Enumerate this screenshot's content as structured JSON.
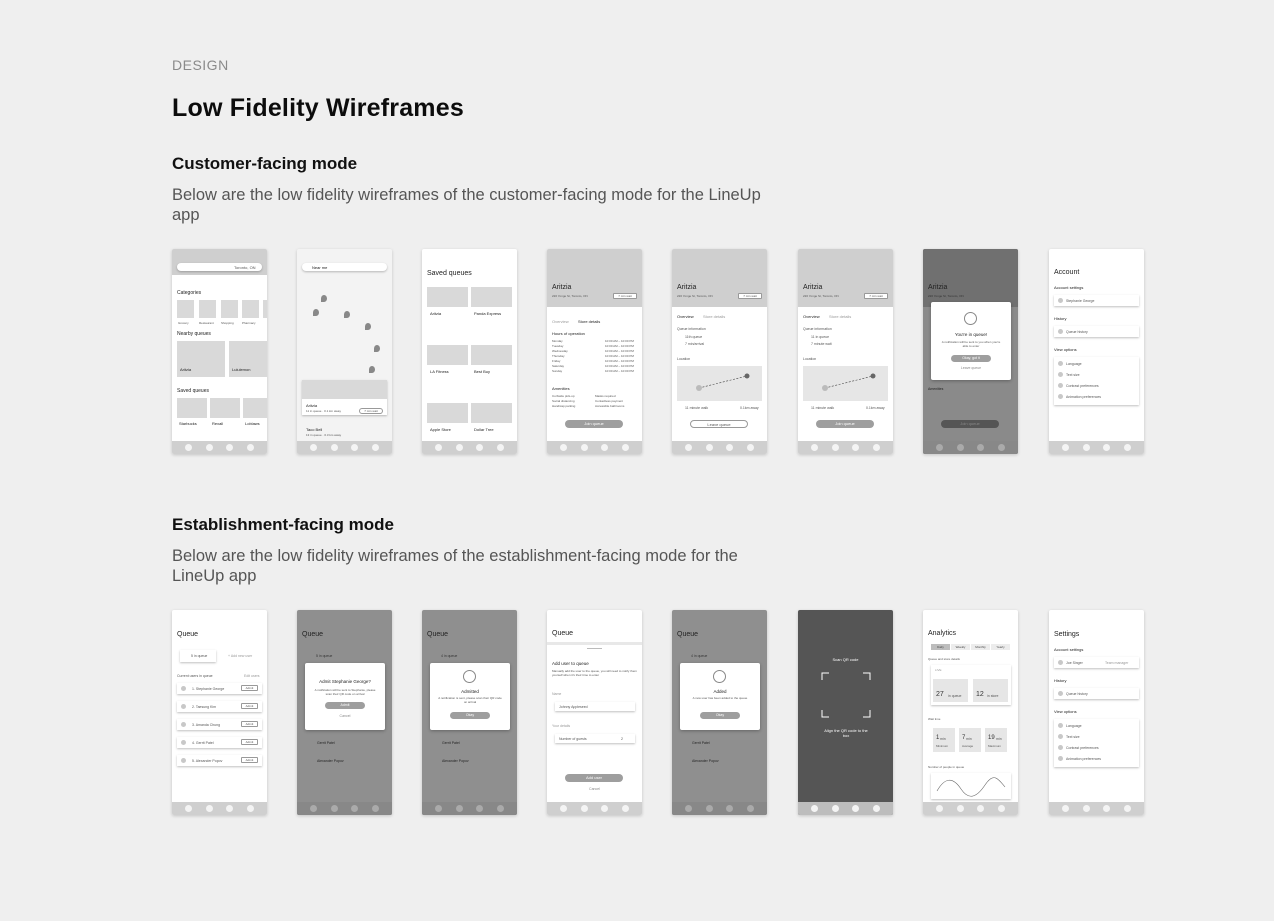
{
  "header": {
    "eyebrow": "DESIGN",
    "title": "Low Fidelity Wireframes"
  },
  "customer": {
    "heading": "Customer-facing mode",
    "description": "Below are the low fidelity wireframes of the customer-facing mode for the LineUp app"
  },
  "establishment": {
    "heading": "Establishment-facing mode",
    "description": "Below are the low fidelity wireframes of the establishment-facing mode for the LineUp app"
  },
  "screens": {
    "c1": {
      "location": "Toronto, ON",
      "categories": "Categories",
      "cats": [
        "Grocery",
        "Restaurant",
        "Shopping",
        "Pharmacy"
      ],
      "nearby": "Nearby queues",
      "nearby_items": [
        "Aritzia",
        "Lululemon"
      ],
      "saved": "Saved queues",
      "saved_items": [
        "Starbucks",
        "Rexall",
        "Loblaws"
      ]
    },
    "c2": {
      "search": "Near me",
      "card1_name": "Aritzia",
      "card1_meta": "11 in queue · 0.1 km away",
      "card1_btn": "7 min wait",
      "card2_name": "Taco Bell",
      "card2_meta": "13 in queue · 0.3 km away",
      "card2_btn": "8 min wait"
    },
    "c3": {
      "title": "Saved queues",
      "items": [
        "Aritzia",
        "Panda Express",
        "LA Fitness",
        "Best Buy",
        "Apple Store",
        "Dollar Tree"
      ]
    },
    "c4": {
      "name": "Aritzia",
      "address": "220 Yonge St, Toronto, ON",
      "wait": "7 min wait",
      "tab1": "Overview",
      "tab2": "Store details",
      "hours_title": "Hours of operation",
      "days": [
        "Monday",
        "Tuesday",
        "Wednesday",
        "Thursday",
        "Friday",
        "Saturday",
        "Sunday"
      ],
      "hours": "10:00 AM – 10:00 PM",
      "amenities": "Amenities",
      "amen_left": [
        "Curbside pick-up",
        "Social distancing",
        "Handicap parking"
      ],
      "amen_right": [
        "Masks required",
        "Contactless payment",
        "Accessible bathrooms"
      ],
      "button": "Join queue"
    },
    "c5": {
      "name": "Aritzia",
      "address": "220 Yonge St, Toronto, ON",
      "wait": "7 min wait",
      "tab1": "Overview",
      "tab2": "Store details",
      "info_title": "Queue information",
      "info1": "11th queue",
      "info2": "7 min/arrival",
      "location": "Location",
      "walk": "11 minute walk",
      "dist": "0.1km away",
      "button": "Leave queue"
    },
    "c6": {
      "name": "Aritzia",
      "address": "220 Yonge St, Toronto, ON",
      "wait": "7 min wait",
      "tab1": "Overview",
      "tab2": "Store details",
      "info_title": "Queue information",
      "info1": "11 in queue",
      "info2": "7 minute wait",
      "location": "Location",
      "walk": "11 minute walk",
      "dist": "0.1km away",
      "button": "Join queue"
    },
    "c7": {
      "name": "Aritzia",
      "address": "220 Yonge St, Toronto, ON",
      "modal_title": "You're in queue!",
      "modal_text": "A notification will be sent to you when you're able to enter",
      "modal_btn": "Okay, got it",
      "modal_link": "Leave queue",
      "amenities": "Amenities",
      "button": "Join queue"
    },
    "c8": {
      "title": "Account",
      "account_settings": "Account settings",
      "user": "Stephanie George",
      "history": "History",
      "queue_history": "Queue history",
      "view_options": "View options",
      "options": [
        "Language",
        "Text size",
        "Contrast preferences",
        "Animation preferences"
      ]
    },
    "e1": {
      "title": "Queue",
      "count": "5 in queue",
      "add": "+ Add new user",
      "current": "Current users in queue",
      "edit": "Edit users",
      "users": [
        "1. Stephanie George",
        "2. Taesung Kim",
        "3. Amanda Chung",
        "4. Gerrit Patel",
        "5. Alexander Popov"
      ],
      "admit": "Admit"
    },
    "e2": {
      "title": "Queue",
      "count": "5 in queue",
      "modal_title": "Admit Stephanie George?",
      "modal_text": "A notification will be sent to Stephanie, please scan their QR code on arrival",
      "modal_btn": "Admit",
      "modal_link": "Cancel",
      "users": [
        "Gerrit Patel",
        "Alexander Popov"
      ],
      "admit": "Admit"
    },
    "e3": {
      "title": "Queue",
      "count": "4 in queue",
      "modal_title": "Admitted",
      "modal_text": "A notification is sent, please scan their QR code on arrival",
      "modal_btn": "Okay",
      "users": [
        "Gerrit Patel",
        "Alexander Popov"
      ],
      "admit": "Admit"
    },
    "e4": {
      "title": "Queue",
      "sheet_title": "Add user to queue",
      "sheet_text": "Manually add the user to the queue, you will need to notify them yourself when it's their time to enter",
      "name_label": "Name",
      "name_value": "Johnny Appleseed",
      "details_label": "Your details",
      "guests_label": "Number of guests",
      "guests_value": "2",
      "button": "Add user",
      "cancel": "Cancel"
    },
    "e5": {
      "title": "Queue",
      "count": "4 in queue",
      "modal_title": "Added",
      "modal_text": "A new user has been added to the queue",
      "modal_btn": "Okay",
      "users": [
        "Gerrit Patel",
        "Alexander Popov"
      ],
      "admit": "Admit"
    },
    "e6": {
      "title": "Scan QR code",
      "hint": "Align the QR code to the box"
    },
    "e7": {
      "title": "Analytics",
      "tabs": [
        "Daily",
        "Weekly",
        "Monthly",
        "Yearly"
      ],
      "queue_details": "Queue and store details",
      "live": "LIVE",
      "in_queue_num": "27",
      "in_queue_label": "in queue",
      "in_store_num": "12",
      "in_store_label": "in store",
      "wait_title": "Wait time",
      "waits": [
        {
          "value": "1",
          "unit": "min",
          "label": "Minimum"
        },
        {
          "value": "7",
          "unit": "min",
          "label": "Average"
        },
        {
          "value": "19",
          "unit": "min",
          "label": "Maximum"
        }
      ],
      "people_title": "Number of people in queue"
    },
    "e8": {
      "title": "Settings",
      "account_settings": "Account settings",
      "user": "Joe Singer",
      "role": "Team manager",
      "history": "History",
      "queue_history": "Queue history",
      "view_options": "View options",
      "options": [
        "Language",
        "Text size",
        "Contrast preferences",
        "Animation preferences"
      ]
    }
  }
}
